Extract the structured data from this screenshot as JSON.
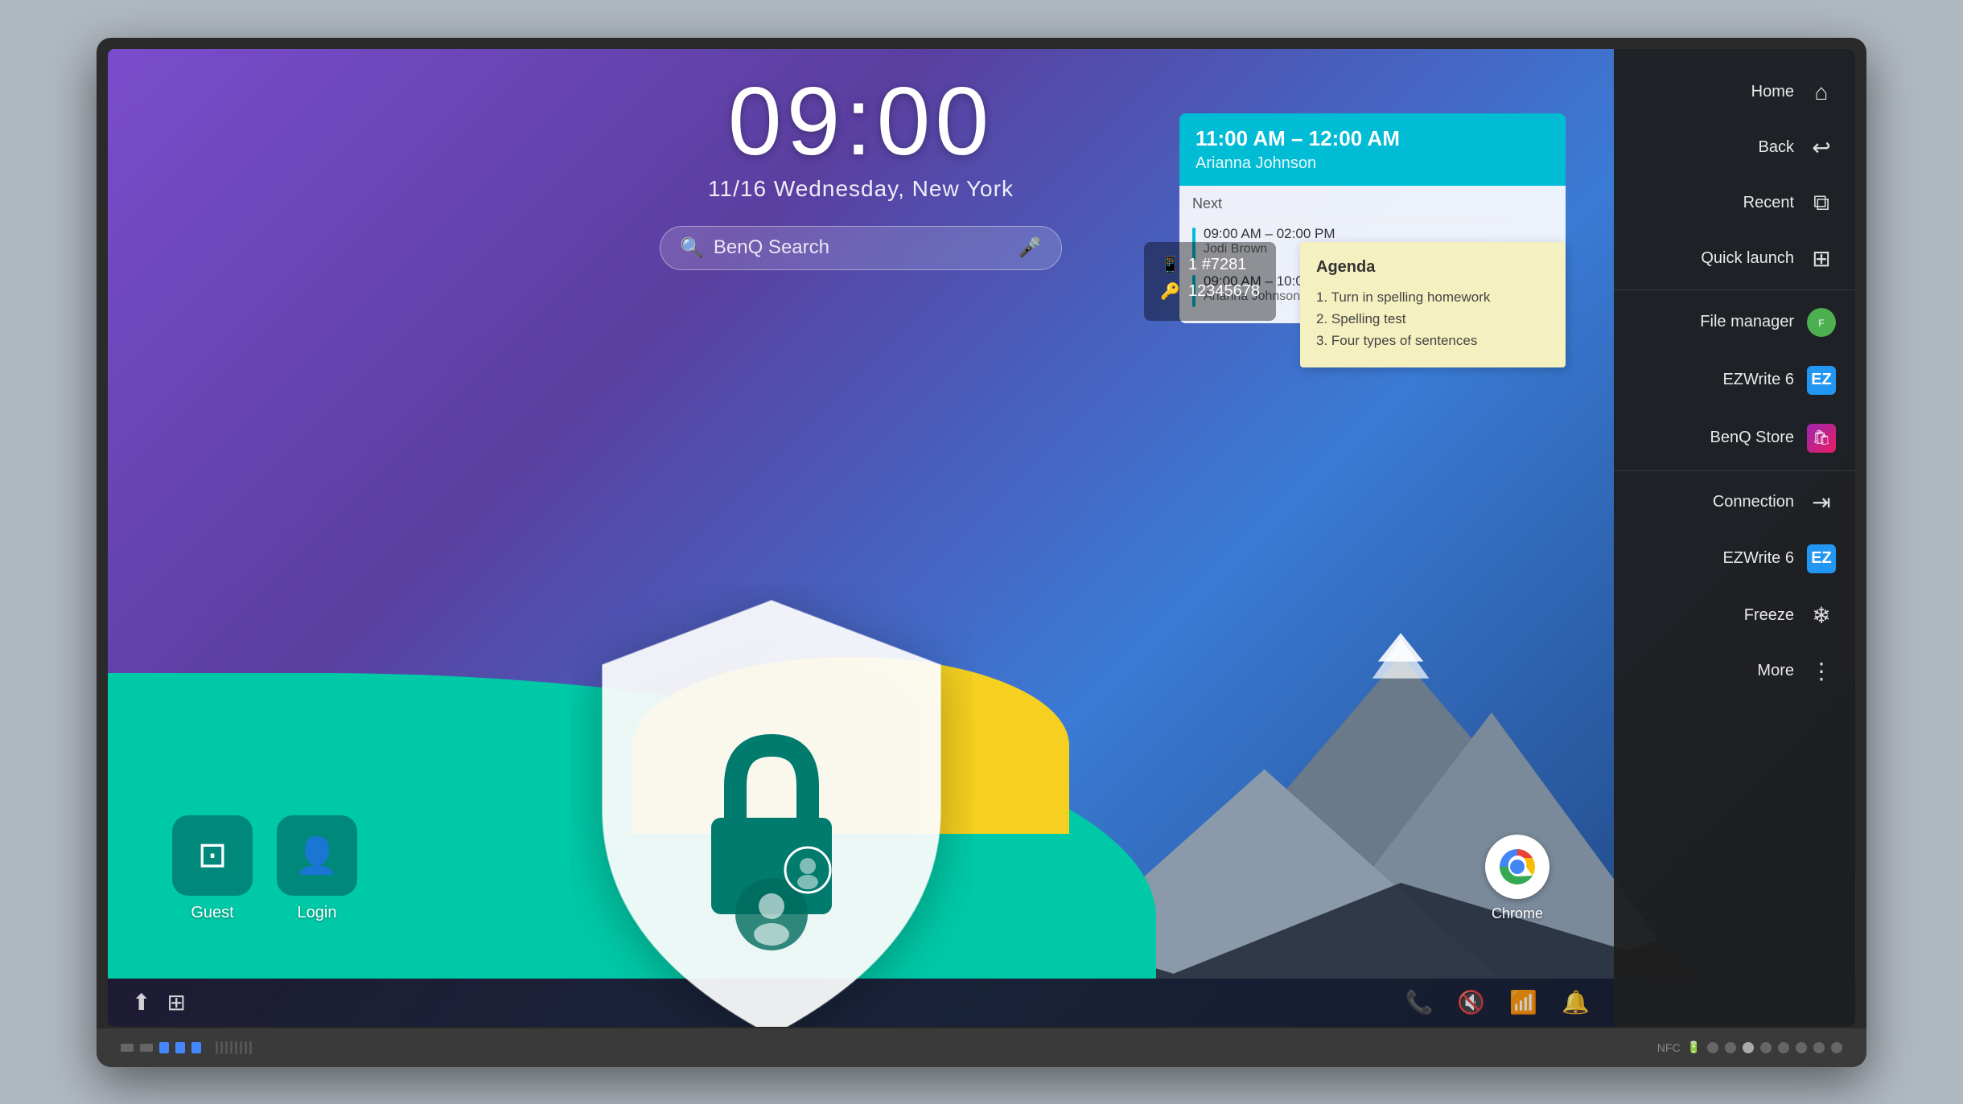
{
  "clock": {
    "time": "09:00",
    "date": "11/16 Wednesday, New York"
  },
  "search": {
    "placeholder": "BenQ Search"
  },
  "calendar": {
    "primary": {
      "time": "11:00 AM – 12:00 AM",
      "name": "Arianna Johnson"
    },
    "next_label": "Next",
    "items": [
      {
        "time": "09:00 AM – 02:00 PM",
        "name": "Jodi Brown"
      },
      {
        "time": "09:00 AM – 10:00 AM",
        "name": "Arianna Johnson"
      }
    ]
  },
  "sticky": {
    "title": "Agenda",
    "items": [
      "1. Turn in spelling homework",
      "2. Spelling test",
      "3. Four types of sentences"
    ]
  },
  "connection": {
    "id": "#7281",
    "password": "12345678"
  },
  "chrome_app": {
    "label": "Chrome"
  },
  "user_buttons": [
    {
      "label": "Guest",
      "icon": "⊡"
    },
    {
      "label": "Login",
      "icon": "👤"
    }
  ],
  "sidebar": {
    "items": [
      {
        "label": "Home",
        "icon": "⌂"
      },
      {
        "label": "Back",
        "icon": "↩"
      },
      {
        "label": "Recent",
        "icon": "⧉"
      },
      {
        "label": "Quick launch",
        "icon": "⊞"
      },
      {
        "label": "File manager",
        "icon": "file-manager"
      },
      {
        "label": "EZWrite 6",
        "icon": "ezwrite"
      },
      {
        "label": "BenQ Store",
        "icon": "benq-store"
      },
      {
        "label": "Connection",
        "icon": "⇥"
      },
      {
        "label": "EZWrite 6",
        "icon": "ezwrite2"
      },
      {
        "label": "Freeze",
        "icon": "❄"
      },
      {
        "label": "More",
        "icon": "⋮"
      }
    ]
  },
  "taskbar": {
    "icons": [
      "share",
      "grid",
      "phone",
      "mute",
      "wifi",
      "bell"
    ]
  },
  "monitor": {
    "bottom_indicator_count": 8
  },
  "colors": {
    "teal": "#00897b",
    "cyan": "#00bcd4",
    "sidebar_bg": "rgba(30,30,30,0.95)",
    "sticky_bg": "#f5f0c0"
  }
}
